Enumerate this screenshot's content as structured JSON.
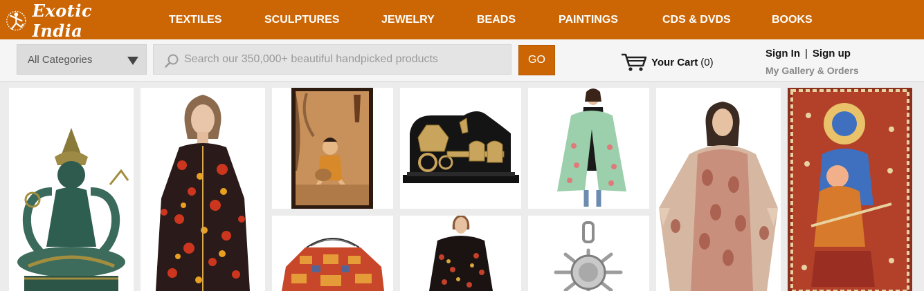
{
  "header": {
    "brand": "Exotic India",
    "nav": [
      "TEXTILES",
      "SCULPTURES",
      "JEWELRY",
      "BEADS",
      "PAINTINGS",
      "CDS & DVDS",
      "BOOKS"
    ]
  },
  "search": {
    "category": "All Categories",
    "placeholder": "Search our 350,000+ beautiful handpicked products",
    "value": "",
    "button_label": "GO"
  },
  "cart": {
    "label": "Your Cart",
    "count": "(0)"
  },
  "account": {
    "sign_in": "Sign In",
    "separator": "|",
    "sign_up": "Sign up",
    "gallery": "My Gallery & Orders"
  },
  "products": [
    {
      "icon": "deity-statue-image"
    },
    {
      "icon": "embroidered-jacket-image"
    },
    {
      "icon": "inlay-krishna-painting-image"
    },
    {
      "icon": "brass-chariot-panel-image"
    },
    {
      "icon": "green-stole-image"
    },
    {
      "icon": "pashmina-shawl-image"
    },
    {
      "icon": "kalamkari-painting-image"
    },
    {
      "icon": "patchwork-bedspread-image"
    },
    {
      "icon": "black-embroidered-stole-image"
    },
    {
      "icon": "silver-sun-pendant-image"
    }
  ],
  "colors": {
    "brand": "#cc6604",
    "background": "#ececec"
  }
}
